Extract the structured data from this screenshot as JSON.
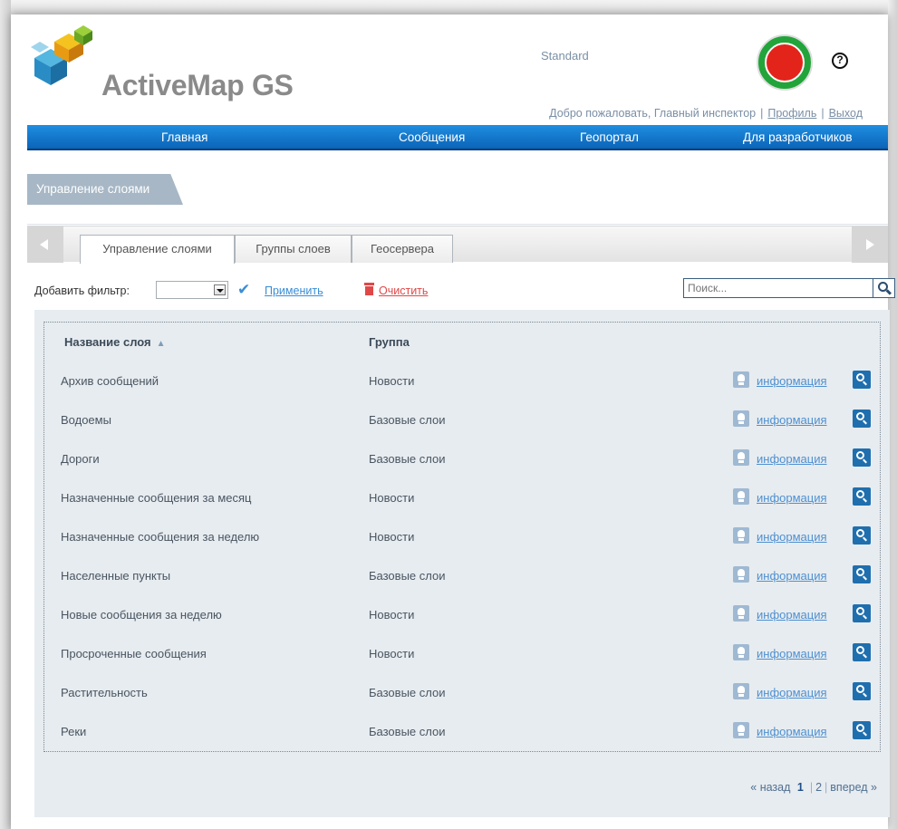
{
  "header": {
    "app_name": "ActiveMap GS",
    "edition": "Standard",
    "welcome": "Добро пожаловать, Главный инспектор",
    "profile_link": "Профиль",
    "logout_link": "Выход",
    "separator": "|",
    "help_glyph": "?"
  },
  "nav": {
    "items": [
      {
        "label": "Главная"
      },
      {
        "label": "Сообщения"
      },
      {
        "label": "Геопортал"
      },
      {
        "label": "Для разработчиков"
      }
    ]
  },
  "page_title": "Управление слоями",
  "tabs": [
    {
      "label": "Управление слоями",
      "active": true
    },
    {
      "label": "Группы слоев",
      "active": false
    },
    {
      "label": "Геосервера",
      "active": false
    }
  ],
  "filter": {
    "label": "Добавить фильтр:",
    "selected": "",
    "apply": "Применить",
    "clear": "Очистить"
  },
  "search": {
    "placeholder": "Поиск..."
  },
  "grid": {
    "columns": [
      "Название слоя",
      "Группа"
    ],
    "sort_indicator": "▲",
    "info_label": "информация",
    "rows": [
      {
        "name": "Архив сообщений",
        "group": "Новости"
      },
      {
        "name": "Водоемы",
        "group": "Базовые слои"
      },
      {
        "name": "Дороги",
        "group": "Базовые слои"
      },
      {
        "name": "Назначенные сообщения за месяц",
        "group": "Новости"
      },
      {
        "name": "Назначенные сообщения за неделю",
        "group": "Новости"
      },
      {
        "name": "Населенные пункты",
        "group": "Базовые слои"
      },
      {
        "name": "Новые сообщения за неделю",
        "group": "Новости"
      },
      {
        "name": "Просроченные сообщения",
        "group": "Новости"
      },
      {
        "name": "Растительность",
        "group": "Базовые слои"
      },
      {
        "name": "Реки",
        "group": "Базовые слои"
      }
    ]
  },
  "pager": {
    "prev": "« назад",
    "pages": [
      "1",
      "2"
    ],
    "current": "1",
    "next": "вперед »"
  },
  "colors": {
    "nav_blue": "#0b64b8",
    "title_tab": "#a7b7c5",
    "link_blue": "#4f90d0",
    "clear_red": "#e04848",
    "grid_bg": "#e7ecf0"
  },
  "icons": {
    "logo": "activemap-cube-logo",
    "emblem": "tatarstan-emblem",
    "help": "question-circle-icon",
    "apply": "checkmark-icon",
    "clear": "trash-icon",
    "search": "search-icon",
    "info": "info-icon",
    "zoom": "zoom-to-layer-icon"
  }
}
